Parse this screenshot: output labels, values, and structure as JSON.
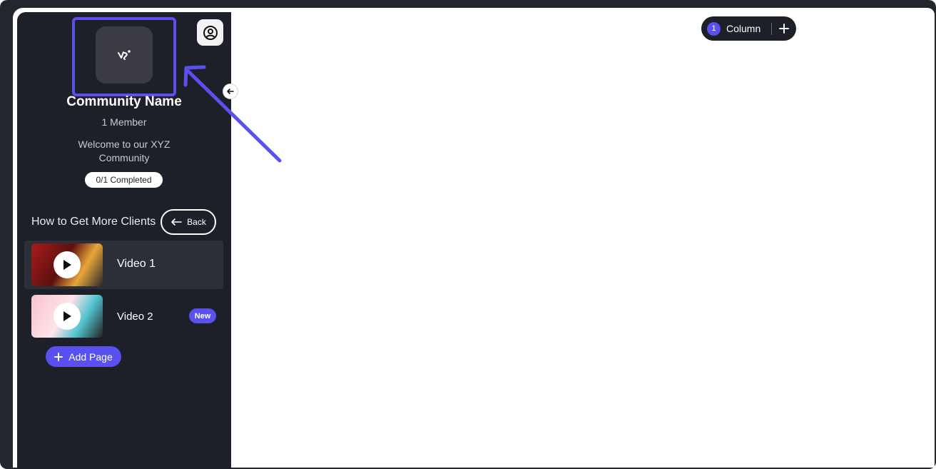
{
  "sidebar": {
    "community_name": "Community Name",
    "member_count": "1 Member",
    "welcome_text": "Welcome to our XYZ Community",
    "progress": "0/1 Completed",
    "section_title": "How to Get More Clients",
    "back_label": "Back",
    "videos": [
      {
        "label": "Video 1",
        "active": true,
        "badge": ""
      },
      {
        "label": "Video 2",
        "active": false,
        "badge": "New"
      }
    ],
    "add_page_label": "Add Page"
  },
  "toolbar": {
    "column_count": "1",
    "column_label": "Column"
  },
  "icons": {
    "logo": "community-logo-icon",
    "profile": "user-circle-icon",
    "collapse": "arrow-left-icon",
    "back": "arrow-left-icon",
    "play": "play-icon",
    "add": "plus-icon"
  },
  "colors": {
    "accent": "#5a50f0",
    "sidebar_bg": "#1d2028",
    "frame_bg": "#24262d"
  }
}
